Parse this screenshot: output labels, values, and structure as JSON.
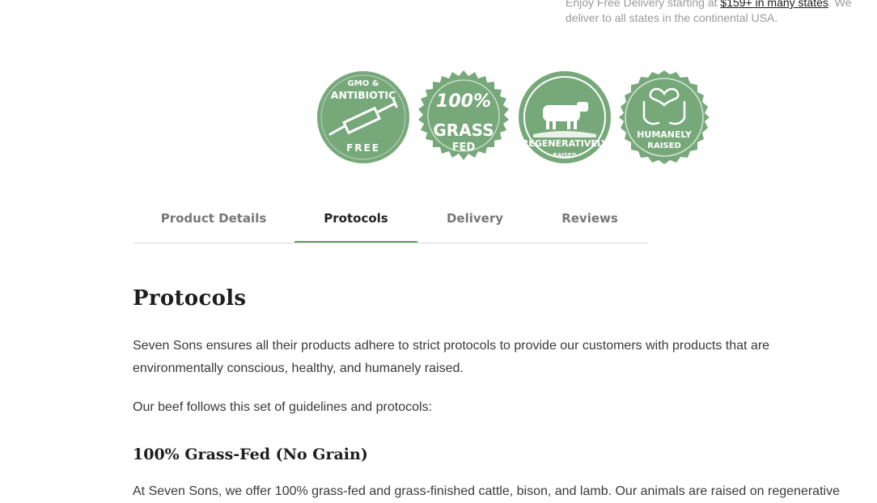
{
  "delivery": {
    "prefix": "Enjoy Free Delivery starting at ",
    "link": "$159+ in many states",
    "suffix": ". We deliver to all states in the continental USA."
  },
  "badges": {
    "gmo": {
      "top": "GMO &",
      "mid": "ANTIBIOTIC",
      "bottom": "FREE"
    },
    "grass": {
      "top": "100%",
      "mid": "GRASS",
      "bottom": "FED"
    },
    "regen": {
      "main": "REGENERATIVELY",
      "sub": "RAISED"
    },
    "humane": {
      "main": "HUMANELY",
      "sub": "RAISED"
    }
  },
  "tabs": [
    {
      "label": "Product Details",
      "active": false
    },
    {
      "label": "Protocols",
      "active": true
    },
    {
      "label": "Delivery",
      "active": false
    },
    {
      "label": "Reviews",
      "active": false
    }
  ],
  "content": {
    "title": "Protocols",
    "intro": "Seven Sons ensures all their products adhere to strict protocols to provide our customers with products that are environmentally conscious, healthy, and humanely raised.",
    "guidelines": "Our beef follows this set of guidelines and protocols:",
    "subheading": "100% Grass-Fed (No Grain)",
    "grassfed_text": "At Seven Sons, we offer 100% grass-fed and grass-finished cattle, bison, and lamb. Our animals are raised on regenerative"
  },
  "colors": {
    "badge_green": "#77a87a",
    "tab_underline": "#6c9a6e"
  }
}
